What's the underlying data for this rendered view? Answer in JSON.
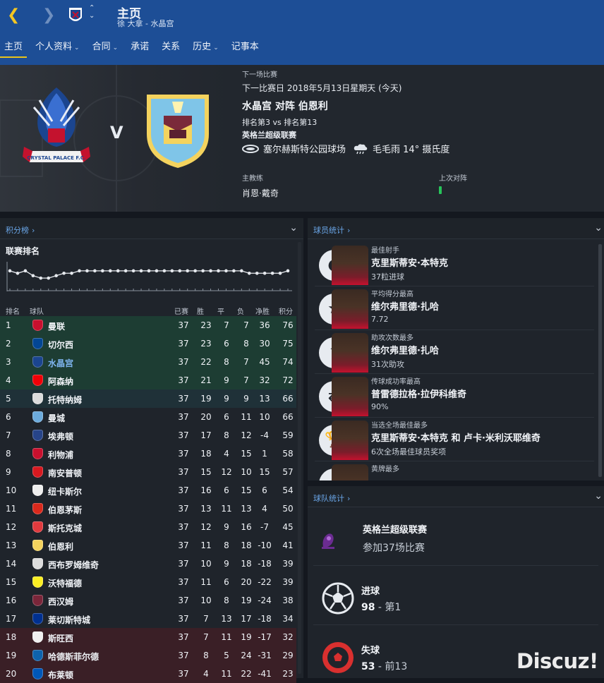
{
  "header": {
    "title": "主页",
    "subtitle": "徐 大拿 - 水晶宫",
    "back_icon": "chevron-left-icon",
    "forward_icon": "chevron-right-icon"
  },
  "tabs": [
    {
      "label": "主页",
      "active": true,
      "dropdown": false
    },
    {
      "label": "个人资料",
      "dropdown": true
    },
    {
      "label": "合同",
      "dropdown": true
    },
    {
      "label": "承诺",
      "dropdown": false
    },
    {
      "label": "关系",
      "dropdown": false
    },
    {
      "label": "历史",
      "dropdown": true
    },
    {
      "label": "记事本",
      "dropdown": false
    }
  ],
  "next_match": {
    "section_label": "下一场比赛",
    "date": "下一比赛日 2018年5月13日星期天 (今天)",
    "fixture": "水晶宫 对阵 伯恩利",
    "positions": "排名第3 vs 排名第13",
    "competition": "英格兰超级联赛",
    "stadium": "塞尔赫斯特公园球场",
    "weather": "毛毛雨 14° 摄氏度",
    "vs": "V",
    "manager_label": "主教练",
    "manager": "肖恩·戴奇",
    "last_meeting_label": "上次对阵"
  },
  "league_panel": {
    "header": "积分榜",
    "title": "联赛排名",
    "columns": [
      "排名",
      "球队",
      "已赛",
      "胜",
      "平",
      "负",
      "净胜",
      "积分"
    ],
    "position_history": [
      3,
      4,
      3,
      5,
      6,
      6,
      5,
      4,
      4,
      3,
      3,
      3,
      3,
      3,
      3,
      3,
      3,
      3,
      3,
      3,
      3,
      3,
      3,
      3,
      3,
      3,
      3,
      3,
      3,
      3,
      3,
      4,
      4,
      4,
      4,
      4,
      3
    ],
    "rows": [
      {
        "pos": "1",
        "team": "曼联",
        "p": "37",
        "w": "23",
        "d": "7",
        "l": "7",
        "gd": "36",
        "pts": "76",
        "zone": "ucl",
        "color": "#c8102e",
        "icon": "man-utd-badge-icon"
      },
      {
        "pos": "2",
        "team": "切尔西",
        "p": "37",
        "w": "23",
        "d": "6",
        "l": "8",
        "gd": "30",
        "pts": "75",
        "zone": "ucl",
        "color": "#034694",
        "icon": "chelsea-badge-icon"
      },
      {
        "pos": "3",
        "team": "水晶宫",
        "p": "37",
        "w": "22",
        "d": "8",
        "l": "7",
        "gd": "45",
        "pts": "74",
        "zone": "ucl",
        "color": "#1b458f",
        "icon": "crystal-palace-badge-icon",
        "highlight": true
      },
      {
        "pos": "4",
        "team": "阿森纳",
        "p": "37",
        "w": "21",
        "d": "9",
        "l": "7",
        "gd": "32",
        "pts": "72",
        "zone": "ucl",
        "color": "#ef0107",
        "icon": "arsenal-badge-icon"
      },
      {
        "pos": "5",
        "team": "托特纳姆",
        "p": "37",
        "w": "19",
        "d": "9",
        "l": "9",
        "gd": "13",
        "pts": "66",
        "zone": "uel",
        "color": "#dcdcdc",
        "icon": "tottenham-badge-icon"
      },
      {
        "pos": "6",
        "team": "曼城",
        "p": "37",
        "w": "20",
        "d": "6",
        "l": "11",
        "gd": "10",
        "pts": "66",
        "zone": "none",
        "color": "#6cabdd",
        "icon": "man-city-badge-icon"
      },
      {
        "pos": "7",
        "team": "埃弗顿",
        "p": "37",
        "w": "17",
        "d": "8",
        "l": "12",
        "gd": "-4",
        "pts": "59",
        "zone": "none",
        "color": "#274488",
        "icon": "everton-badge-icon"
      },
      {
        "pos": "8",
        "team": "利物浦",
        "p": "37",
        "w": "18",
        "d": "4",
        "l": "15",
        "gd": "1",
        "pts": "58",
        "zone": "none",
        "color": "#c8102e",
        "icon": "liverpool-badge-icon"
      },
      {
        "pos": "9",
        "team": "南安普顿",
        "p": "37",
        "w": "15",
        "d": "12",
        "l": "10",
        "gd": "15",
        "pts": "57",
        "zone": "none",
        "color": "#d71920",
        "icon": "southampton-badge-icon"
      },
      {
        "pos": "10",
        "team": "纽卡斯尔",
        "p": "37",
        "w": "16",
        "d": "6",
        "l": "15",
        "gd": "6",
        "pts": "54",
        "zone": "none",
        "color": "#eeeeee",
        "icon": "newcastle-badge-icon"
      },
      {
        "pos": "11",
        "team": "伯恩茅斯",
        "p": "37",
        "w": "13",
        "d": "11",
        "l": "13",
        "gd": "4",
        "pts": "50",
        "zone": "none",
        "color": "#da291c",
        "icon": "bournemouth-badge-icon"
      },
      {
        "pos": "12",
        "team": "斯托克城",
        "p": "37",
        "w": "12",
        "d": "9",
        "l": "16",
        "gd": "-7",
        "pts": "45",
        "zone": "none",
        "color": "#e03a3e",
        "icon": "stoke-badge-icon"
      },
      {
        "pos": "13",
        "team": "伯恩利",
        "p": "37",
        "w": "11",
        "d": "8",
        "l": "18",
        "gd": "-10",
        "pts": "41",
        "zone": "none",
        "color": "#f4d35e",
        "icon": "burnley-badge-icon"
      },
      {
        "pos": "14",
        "team": "西布罗姆维奇",
        "p": "37",
        "w": "10",
        "d": "9",
        "l": "18",
        "gd": "-18",
        "pts": "39",
        "zone": "none",
        "color": "#dddddd",
        "icon": "west-brom-badge-icon"
      },
      {
        "pos": "15",
        "team": "沃特福德",
        "p": "37",
        "w": "11",
        "d": "6",
        "l": "20",
        "gd": "-22",
        "pts": "39",
        "zone": "none",
        "color": "#fbee23",
        "icon": "watford-badge-icon"
      },
      {
        "pos": "16",
        "team": "西汉姆",
        "p": "37",
        "w": "10",
        "d": "8",
        "l": "19",
        "gd": "-24",
        "pts": "38",
        "zone": "none",
        "color": "#7a263a",
        "icon": "west-ham-badge-icon"
      },
      {
        "pos": "17",
        "team": "莱切斯特城",
        "p": "37",
        "w": "7",
        "d": "13",
        "l": "17",
        "gd": "-18",
        "pts": "34",
        "zone": "none",
        "color": "#003090",
        "icon": "leicester-badge-icon"
      },
      {
        "pos": "18",
        "team": "斯旺西",
        "p": "37",
        "w": "7",
        "d": "11",
        "l": "19",
        "gd": "-17",
        "pts": "32",
        "zone": "rel",
        "color": "#f0f0f0",
        "icon": "swansea-badge-icon"
      },
      {
        "pos": "19",
        "team": "哈德斯菲尔德",
        "p": "37",
        "w": "8",
        "d": "5",
        "l": "24",
        "gd": "-31",
        "pts": "29",
        "zone": "rel",
        "color": "#0e63ad",
        "icon": "huddersfield-badge-icon"
      },
      {
        "pos": "20",
        "team": "布莱顿",
        "p": "37",
        "w": "4",
        "d": "11",
        "l": "22",
        "gd": "-41",
        "pts": "23",
        "zone": "rel",
        "color": "#0057b8",
        "icon": "brighton-badge-icon"
      }
    ]
  },
  "player_panel": {
    "header": "球员统计",
    "items": [
      {
        "category": "最佳射手",
        "name": "克里斯蒂安·本特克",
        "value": "37粒进球",
        "icon": "football-icon"
      },
      {
        "category": "平均得分最高",
        "name": "维尔弗里德·扎哈",
        "value": "7.72",
        "icon": "star-icon"
      },
      {
        "category": "助攻次数最多",
        "name": "维尔弗里德·扎哈",
        "value": "31次助攻",
        "icon": "assist-arrow-icon"
      },
      {
        "category": "传球成功率最高",
        "name": "普雷德拉格·拉伊科维奇",
        "value": "90%",
        "icon": "pass-icon"
      },
      {
        "category": "当选全场最佳最多",
        "name": "克里斯蒂安·本特克 和 卢卡·米利沃耶维奇",
        "value": "6次全场最佳球员奖项",
        "icon": "trophy-icon"
      },
      {
        "category": "黄牌最多",
        "name": "",
        "value": "",
        "icon": "yellow-card-icon"
      }
    ]
  },
  "team_panel": {
    "header": "球队统计",
    "league": "英格兰超级联赛",
    "played": "参加37场比赛",
    "goals_label": "进球",
    "goals_value": "98",
    "goals_rank": " - 第1",
    "conceded_label": "失球",
    "conceded_value": "53",
    "conceded_rank": " - 前13"
  },
  "watermark": "Discuz!"
}
